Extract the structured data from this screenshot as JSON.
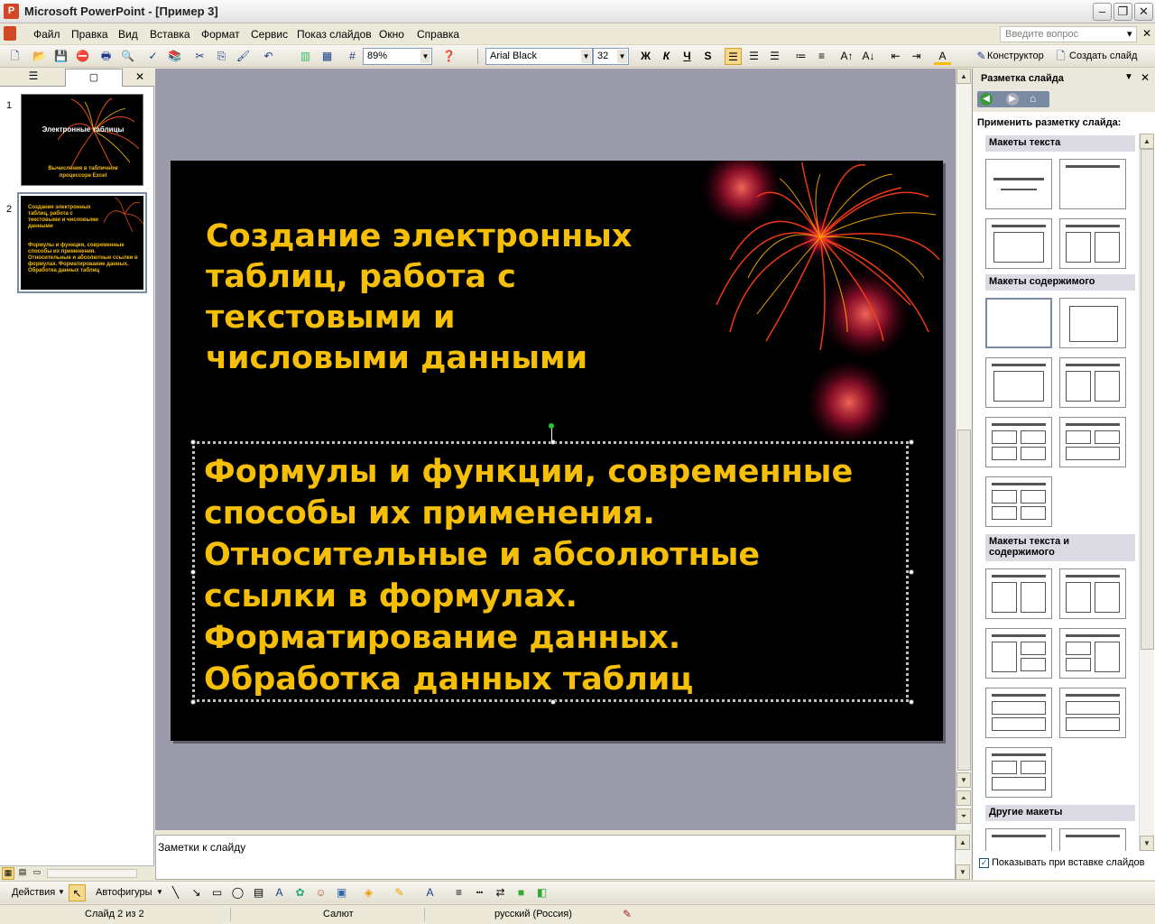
{
  "window": {
    "title": "Microsoft PowerPoint - [Пример 3]",
    "app_icon": "P"
  },
  "menu": {
    "items": [
      "Файл",
      "Правка",
      "Вид",
      "Вставка",
      "Формат",
      "Сервис",
      "Показ слайдов",
      "Окно",
      "Справка"
    ],
    "help_placeholder": "Введите вопрос"
  },
  "toolbar": {
    "zoom": "89%",
    "font": "Arial Black",
    "font_size": "32",
    "bold": "Ж",
    "italic": "К",
    "underline": "Ч",
    "shadow": "S",
    "designer": "Конструктор",
    "new_slide": "Создать слайд"
  },
  "left_panel": {
    "close": "✕",
    "slides": [
      {
        "number": "1",
        "title": "Электронные таблицы",
        "subtitle": "Вычисления в табличном процессоре Excel"
      },
      {
        "number": "2",
        "title": "Создание электронных таблиц, работа с текстовыми и числовыми данными",
        "body": "Формулы и функции, современные способы их применения. Относительные и абсолютные ссылки в формулах. Форматирование данных. Обработка данных таблиц"
      }
    ]
  },
  "slide": {
    "title": "Создание электронных\nтаблиц, работа с\nтекстовыми и\nчисловыми данными",
    "body": "Формулы и функции, современные\nспособы их применения.\nОтносительные и абсолютные\nссылки  в формулах.\nФорматирование данных.\nОбработка данных таблиц",
    "text_color": "#f5be07",
    "background": "#000000"
  },
  "notes": {
    "placeholder": "Заметки к слайду"
  },
  "task_pane": {
    "title": "Разметка слайда",
    "apply_label": "Применить разметку слайда:",
    "sections": [
      "Макеты текста",
      "Макеты содержимого",
      "Макеты текста и содержимого",
      "Другие макеты"
    ],
    "show_on_insert": "Показывать при вставке слайдов",
    "show_on_insert_checked": true
  },
  "drawing": {
    "actions": "Действия",
    "autoshapes": "Автофигуры"
  },
  "status": {
    "slide": "Слайд 2 из 2",
    "design": "Салют",
    "language": "русский (Россия)"
  },
  "colors": {
    "accent": "#f5be07",
    "workspace": "#9a9aaa",
    "chrome": "#ece9d8"
  }
}
